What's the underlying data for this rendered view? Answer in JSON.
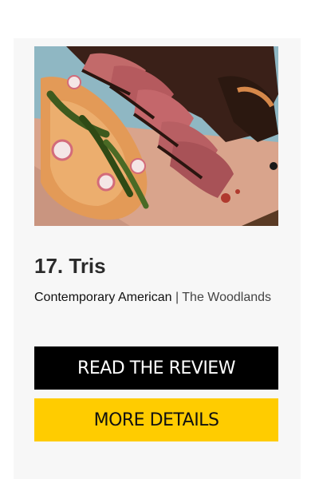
{
  "card": {
    "image": {
      "description": "sliced grilled steak with roasted peppers, radishes and mashed sweet potato on butcher paper"
    },
    "title": "17. Tris",
    "cuisine": "Contemporary American",
    "separator": " | ",
    "location": "The Woodlands",
    "buttons": {
      "review_label": "READ THE REVIEW",
      "details_label": "MORE DETAILS"
    }
  },
  "colors": {
    "card_background": "#f7f7f7",
    "review_button": "#000000",
    "details_button": "#ffcc00"
  }
}
